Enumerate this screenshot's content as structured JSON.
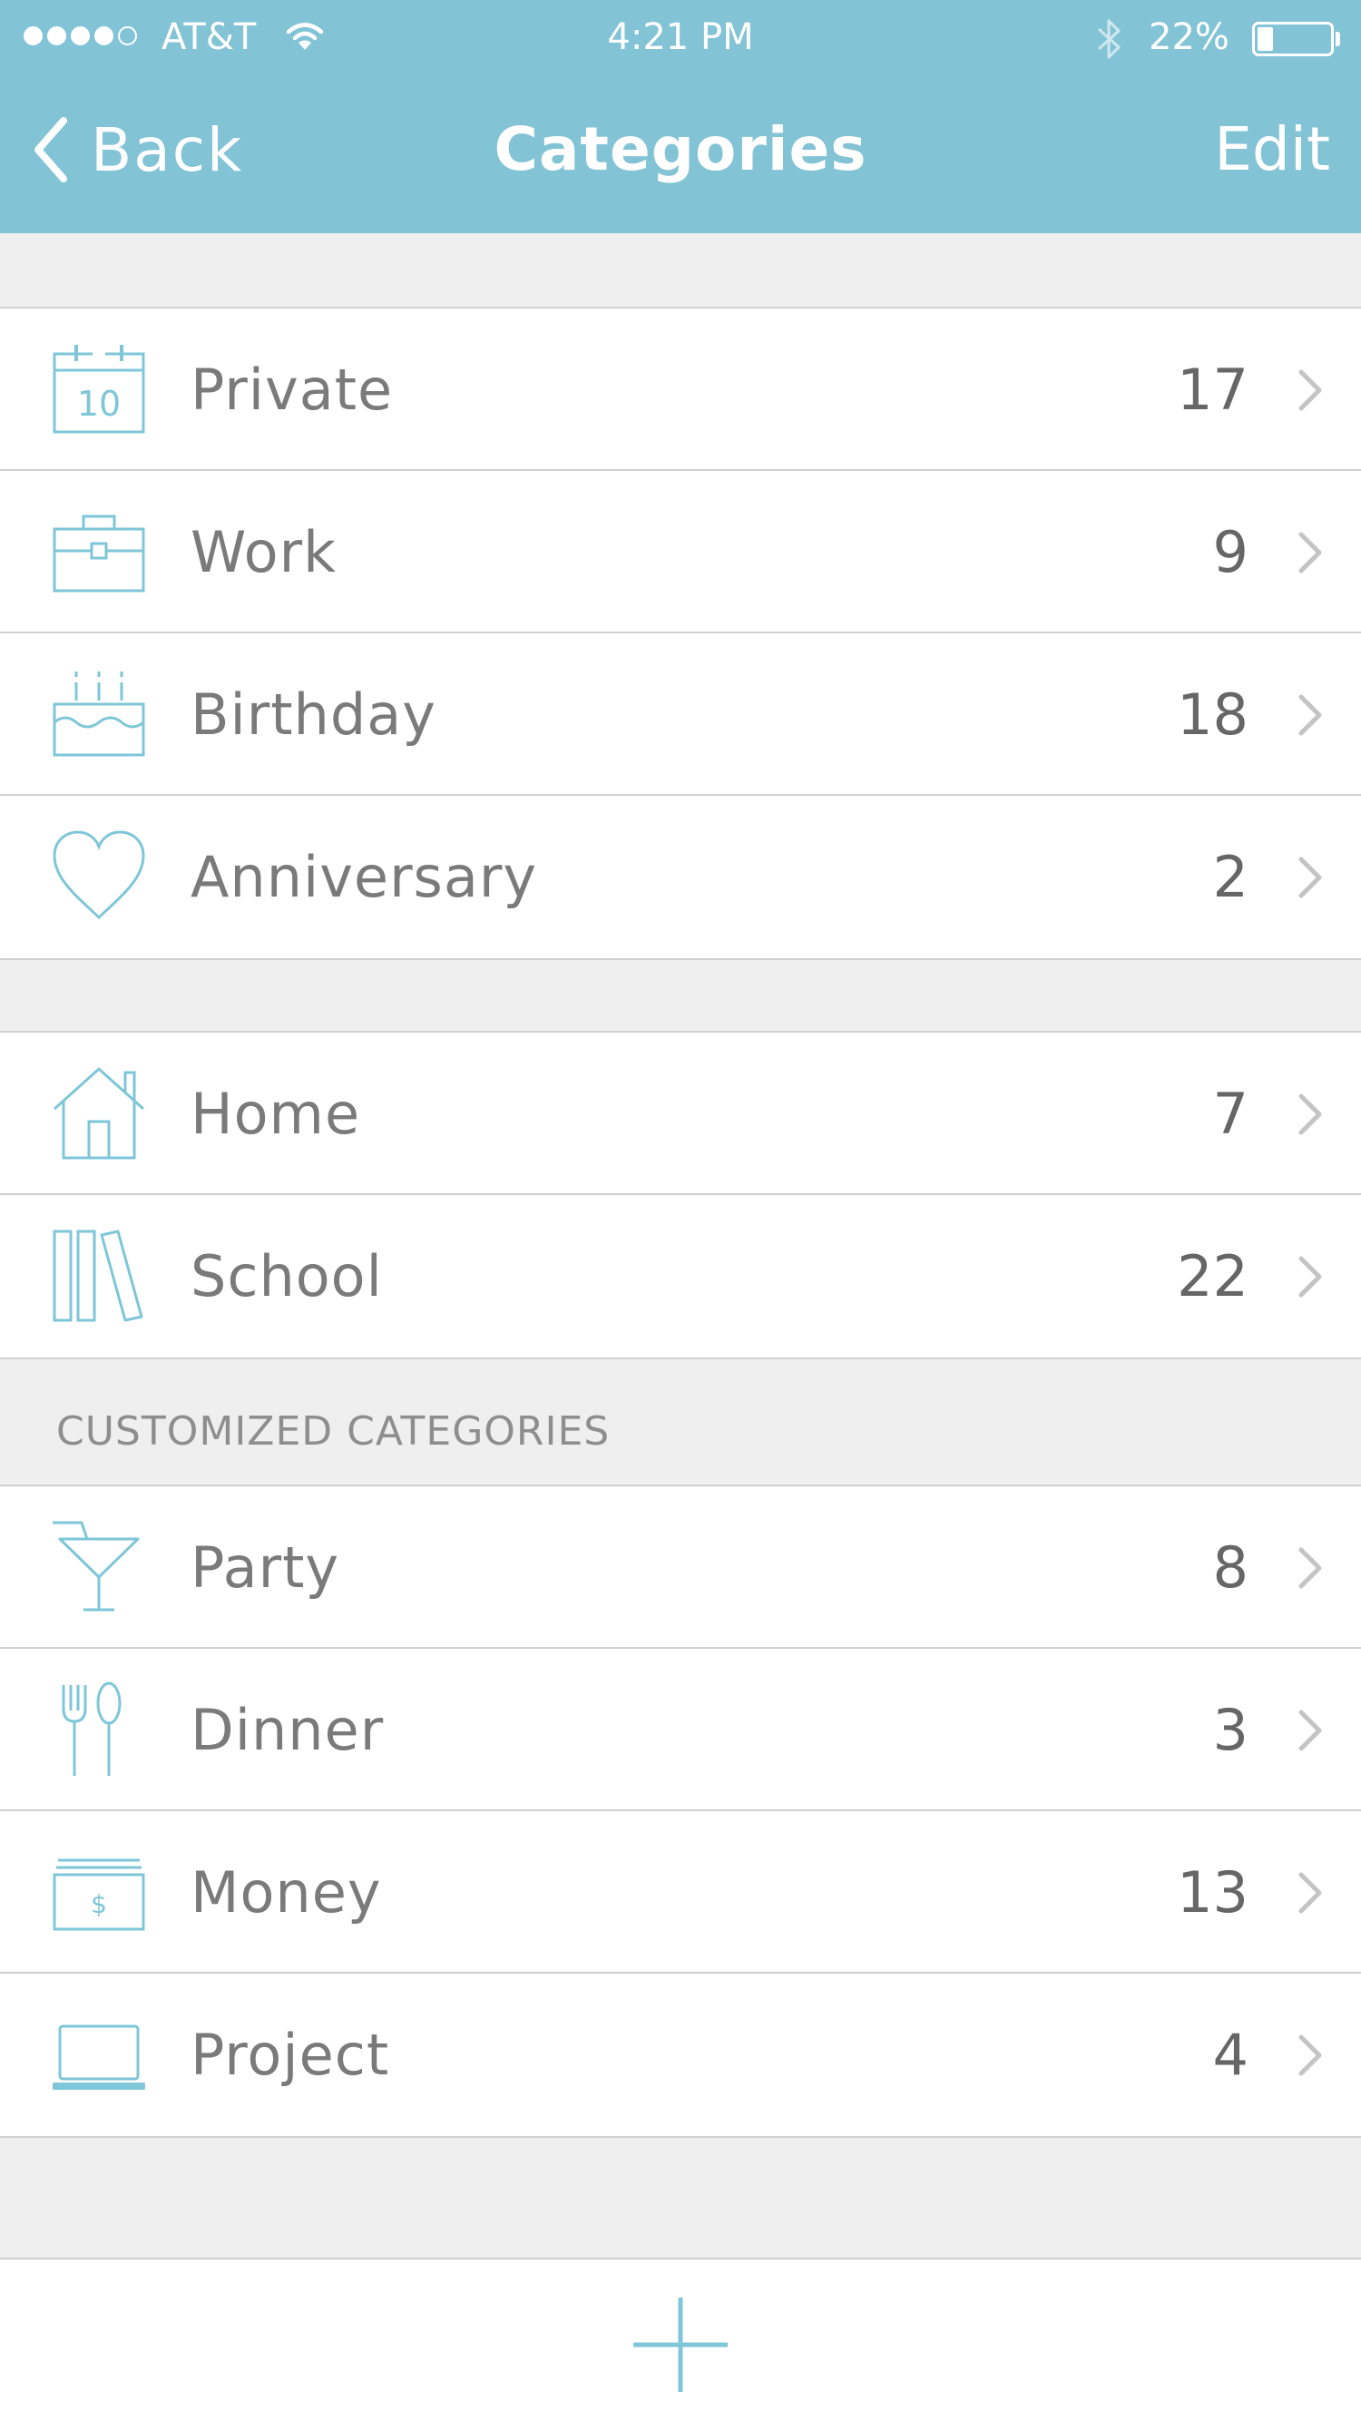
{
  "status_bar": {
    "carrier": "AT&T",
    "time": "4:21 PM",
    "battery_percent_label": "22%",
    "battery_level": 0.22,
    "signal_bars": 4
  },
  "navbar": {
    "back_label": "Back",
    "title": "Categories",
    "edit_label": "Edit"
  },
  "colors": {
    "accent": "#82c3d6",
    "icon": "#7ec6d8",
    "text": "#7a7a7a",
    "count": "#666666",
    "chevron": "#c4c4c4"
  },
  "groups": [
    {
      "items": [
        {
          "label": "Private",
          "count": "17",
          "icon": "calendar-icon"
        },
        {
          "label": "Work",
          "count": "9",
          "icon": "briefcase-icon"
        },
        {
          "label": "Birthday",
          "count": "18",
          "icon": "cake-icon"
        },
        {
          "label": "Anniversary",
          "count": "2",
          "icon": "heart-icon"
        }
      ]
    },
    {
      "items": [
        {
          "label": "Home",
          "count": "7",
          "icon": "house-icon"
        },
        {
          "label": "School",
          "count": "22",
          "icon": "books-icon"
        }
      ]
    },
    {
      "header": "CUSTOMIZED CATEGORIES",
      "items": [
        {
          "label": "Party",
          "count": "8",
          "icon": "cocktail-icon"
        },
        {
          "label": "Dinner",
          "count": "3",
          "icon": "fork-spoon-icon"
        },
        {
          "label": "Money",
          "count": "13",
          "icon": "money-icon"
        },
        {
          "label": "Project",
          "count": "4",
          "icon": "laptop-icon"
        }
      ]
    }
  ],
  "bottom_bar": {
    "add_icon": "plus-icon"
  }
}
